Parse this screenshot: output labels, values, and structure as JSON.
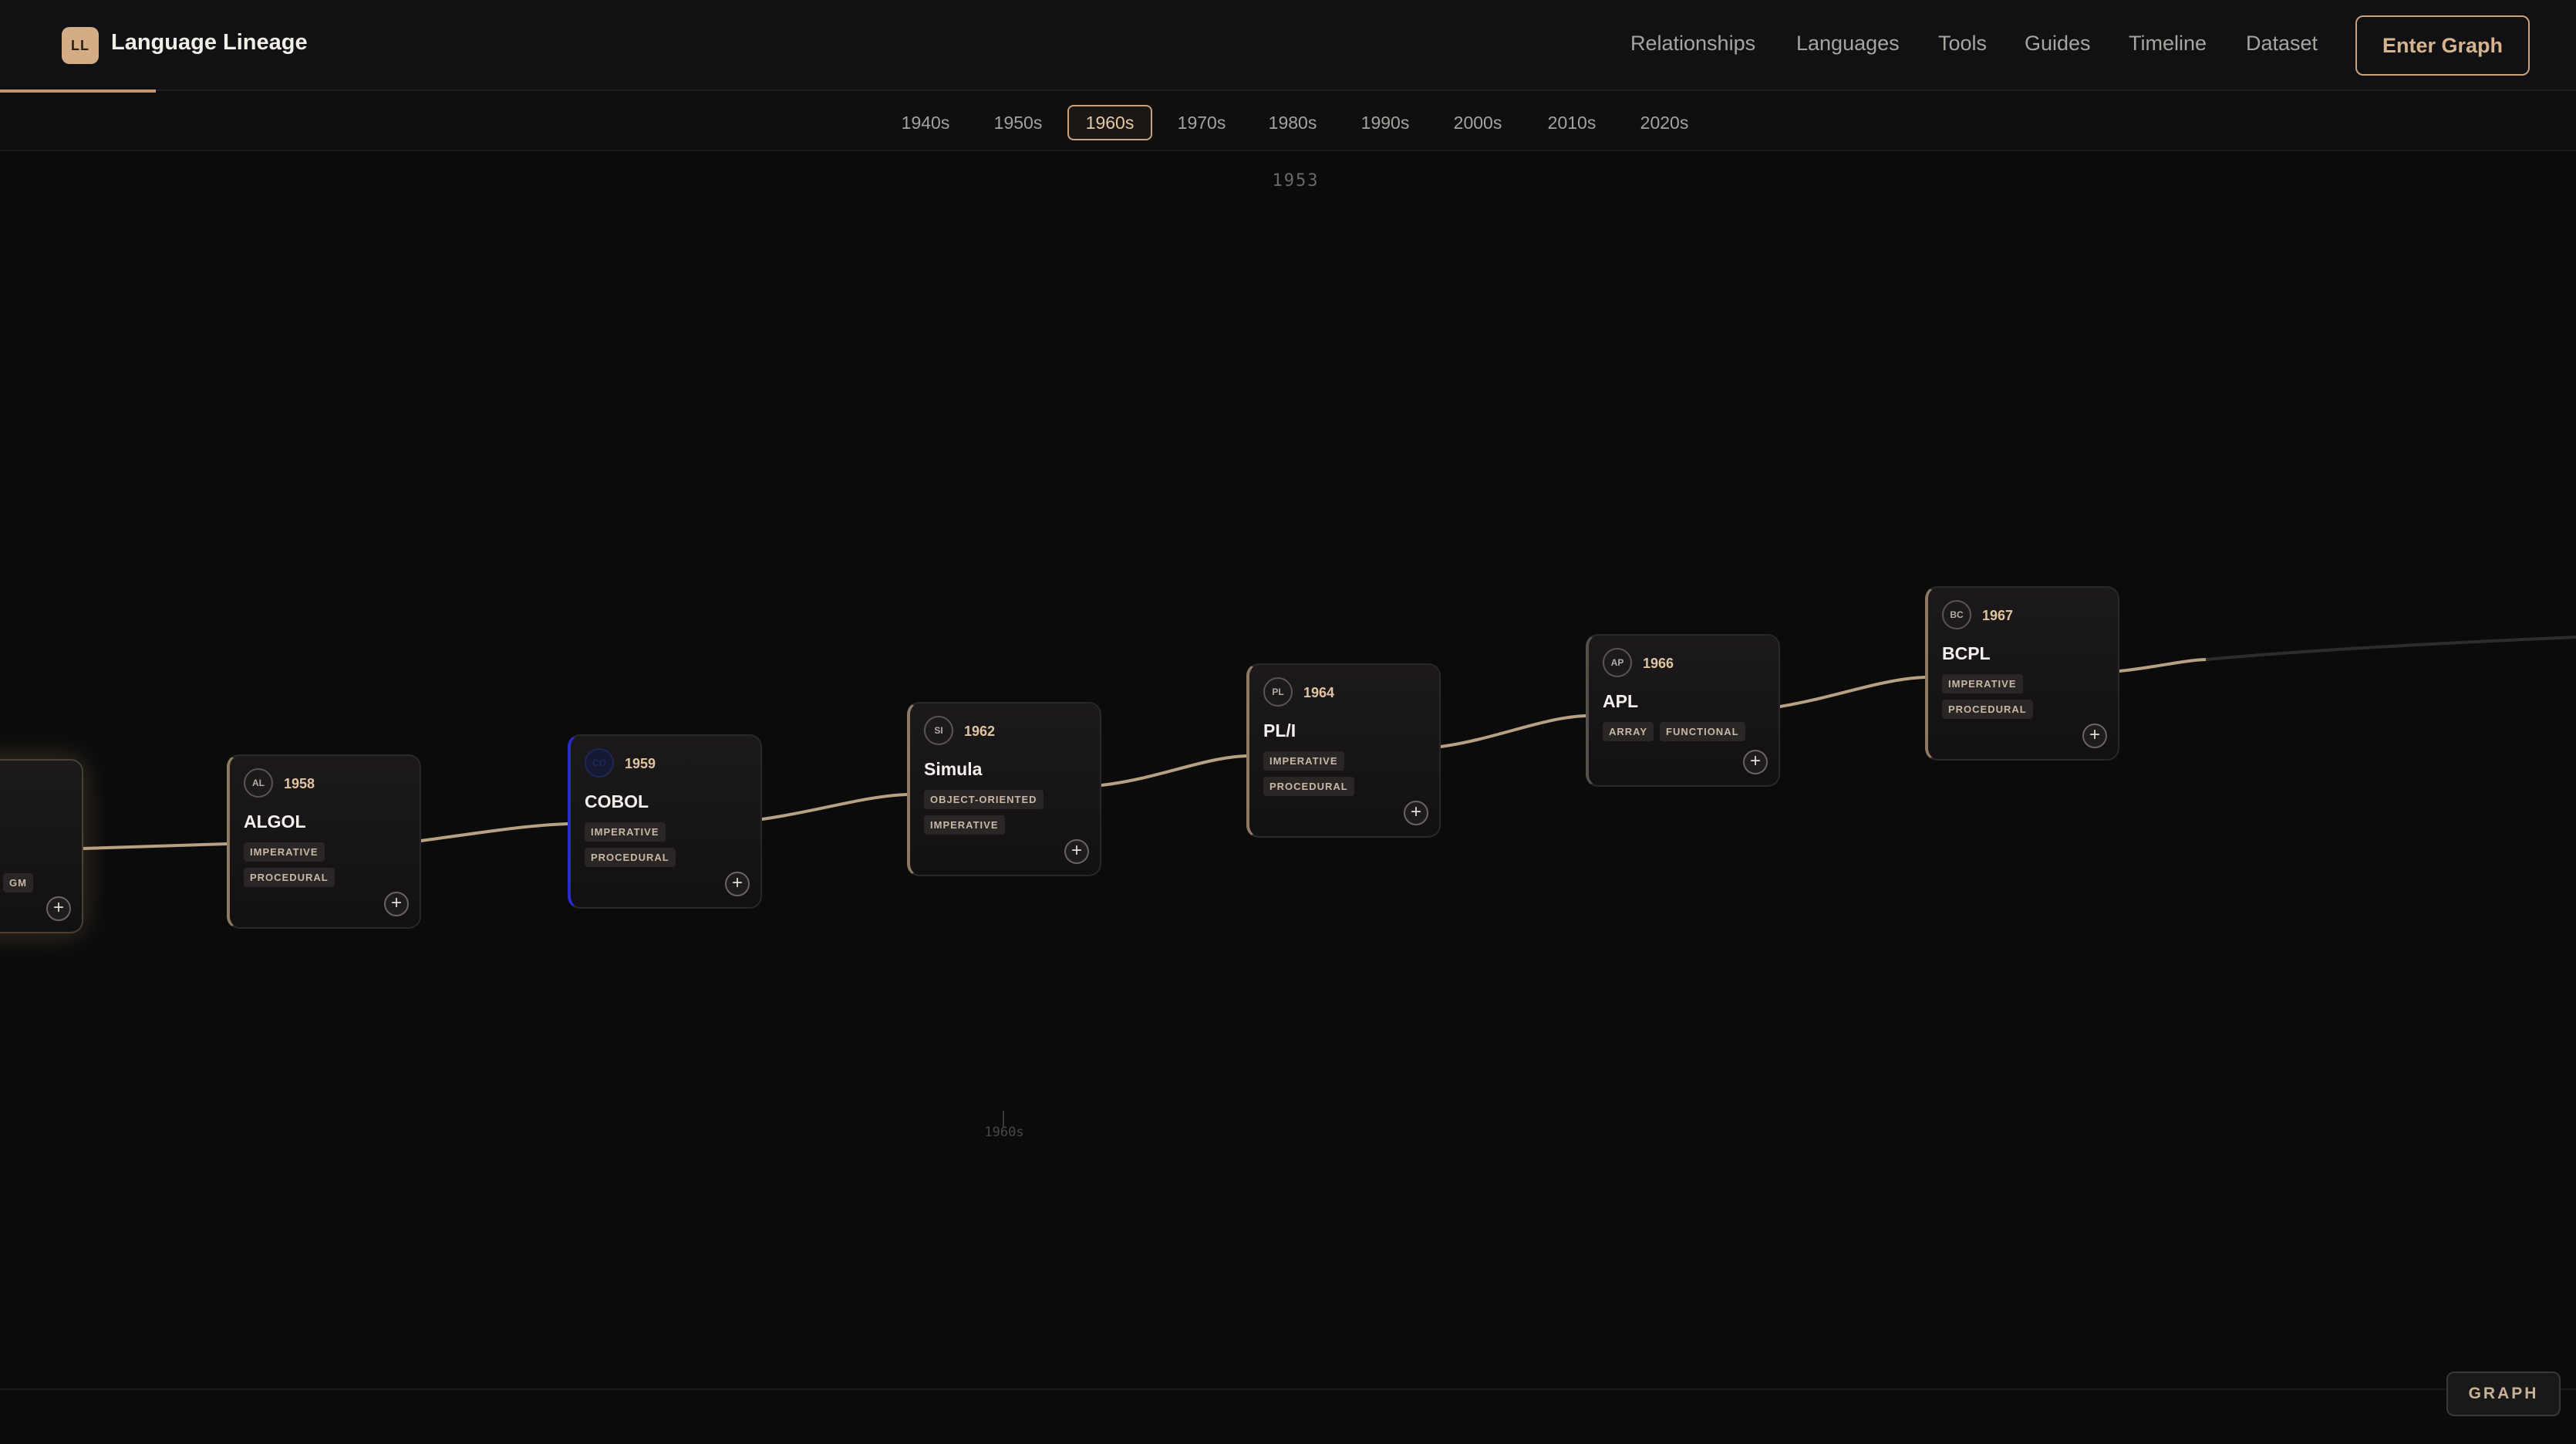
{
  "app": {
    "logo_initials": "LL",
    "title": "Language Lineage"
  },
  "nav": {
    "items": [
      "Relationships",
      "Languages",
      "Tools",
      "Guides",
      "Timeline",
      "Dataset"
    ],
    "cta_label": "Enter Graph"
  },
  "decades": {
    "items": [
      "1940s",
      "1950s",
      "1960s",
      "1970s",
      "1980s",
      "1990s",
      "2000s",
      "2010s",
      "2020s"
    ],
    "active": "1960s"
  },
  "canvas": {
    "focus_year": "1953",
    "axis_label": "1960s",
    "partial_node_tag": "GM"
  },
  "nodes": [
    {
      "initials": "AL",
      "year": "1958",
      "name": "ALGOL",
      "tags": [
        "IMPERATIVE",
        "PROCEDURAL"
      ]
    },
    {
      "initials": "CO",
      "year": "1959",
      "name": "COBOL",
      "tags": [
        "IMPERATIVE",
        "PROCEDURAL"
      ]
    },
    {
      "initials": "SI",
      "year": "1962",
      "name": "Simula",
      "tags": [
        "OBJECT-ORIENTED",
        "IMPERATIVE"
      ]
    },
    {
      "initials": "PL",
      "year": "1964",
      "name": "PL/I",
      "tags": [
        "IMPERATIVE",
        "PROCEDURAL"
      ]
    },
    {
      "initials": "AP",
      "year": "1966",
      "name": "APL",
      "tags": [
        "ARRAY",
        "FUNCTIONAL"
      ]
    },
    {
      "initials": "BC",
      "year": "1967",
      "name": "BCPL",
      "tags": [
        "IMPERATIVE",
        "PROCEDURAL"
      ]
    }
  ],
  "node_add_symbol": "+",
  "footer": {
    "mode_label": "GRAPH"
  },
  "colors": {
    "accent": "#c9a27c",
    "background": "#0b0b0b",
    "link": "#b8a082"
  }
}
